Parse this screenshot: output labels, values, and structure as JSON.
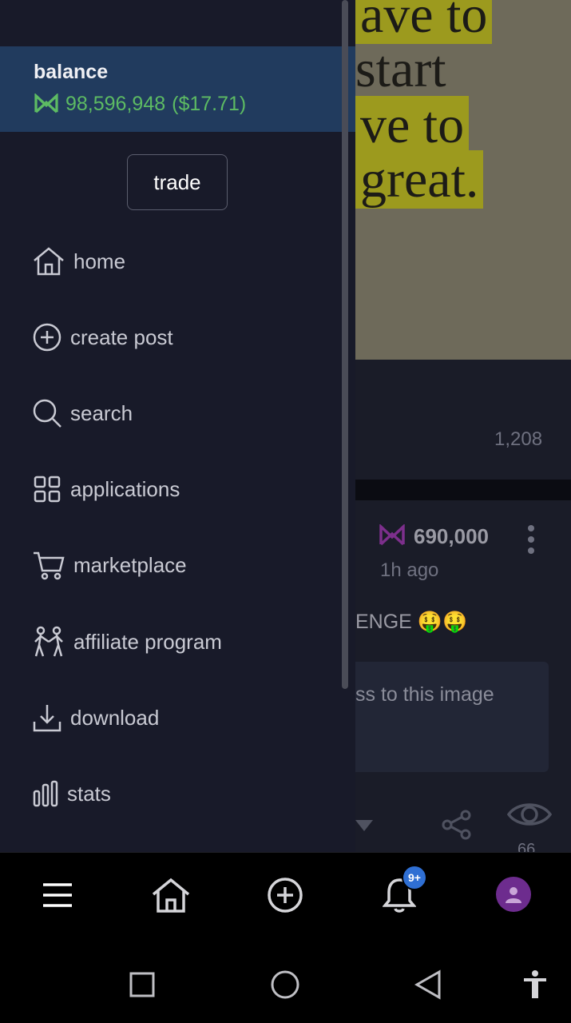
{
  "drawer": {
    "balance_label": "balance",
    "balance_amount": "98,596,948",
    "balance_usd": "($17.71)",
    "trade_label": "trade",
    "nav_items": [
      {
        "label": "home",
        "icon": "home-icon"
      },
      {
        "label": "create post",
        "icon": "plus-circle-icon"
      },
      {
        "label": "search",
        "icon": "search-icon"
      },
      {
        "label": "applications",
        "icon": "grid-icon"
      },
      {
        "label": "marketplace",
        "icon": "cart-icon"
      },
      {
        "label": "affiliate program",
        "icon": "people-icon"
      },
      {
        "label": "download",
        "icon": "download-icon"
      },
      {
        "label": "stats",
        "icon": "bar-chart-icon"
      }
    ]
  },
  "feed": {
    "image_text": [
      "ave to",
      "start",
      "ve to",
      "great."
    ],
    "views_1": "1,208",
    "post2_amount": "690,000",
    "post2_time": "1h ago",
    "post2_text": "ENGE",
    "post2_box_text": "ss to this image",
    "views_2": "66"
  },
  "bottom_nav": {
    "notification_badge": "9+",
    "icons": [
      "menu-icon",
      "home-icon",
      "plus-circle-icon",
      "bell-icon",
      "avatar"
    ]
  },
  "colors": {
    "drawer_bg": "#181a29",
    "balance_bg": "#213b5e",
    "balance_green": "#5dbb63",
    "badge_blue": "#2f6fd3",
    "avatar_purple": "#6d2c8e"
  }
}
